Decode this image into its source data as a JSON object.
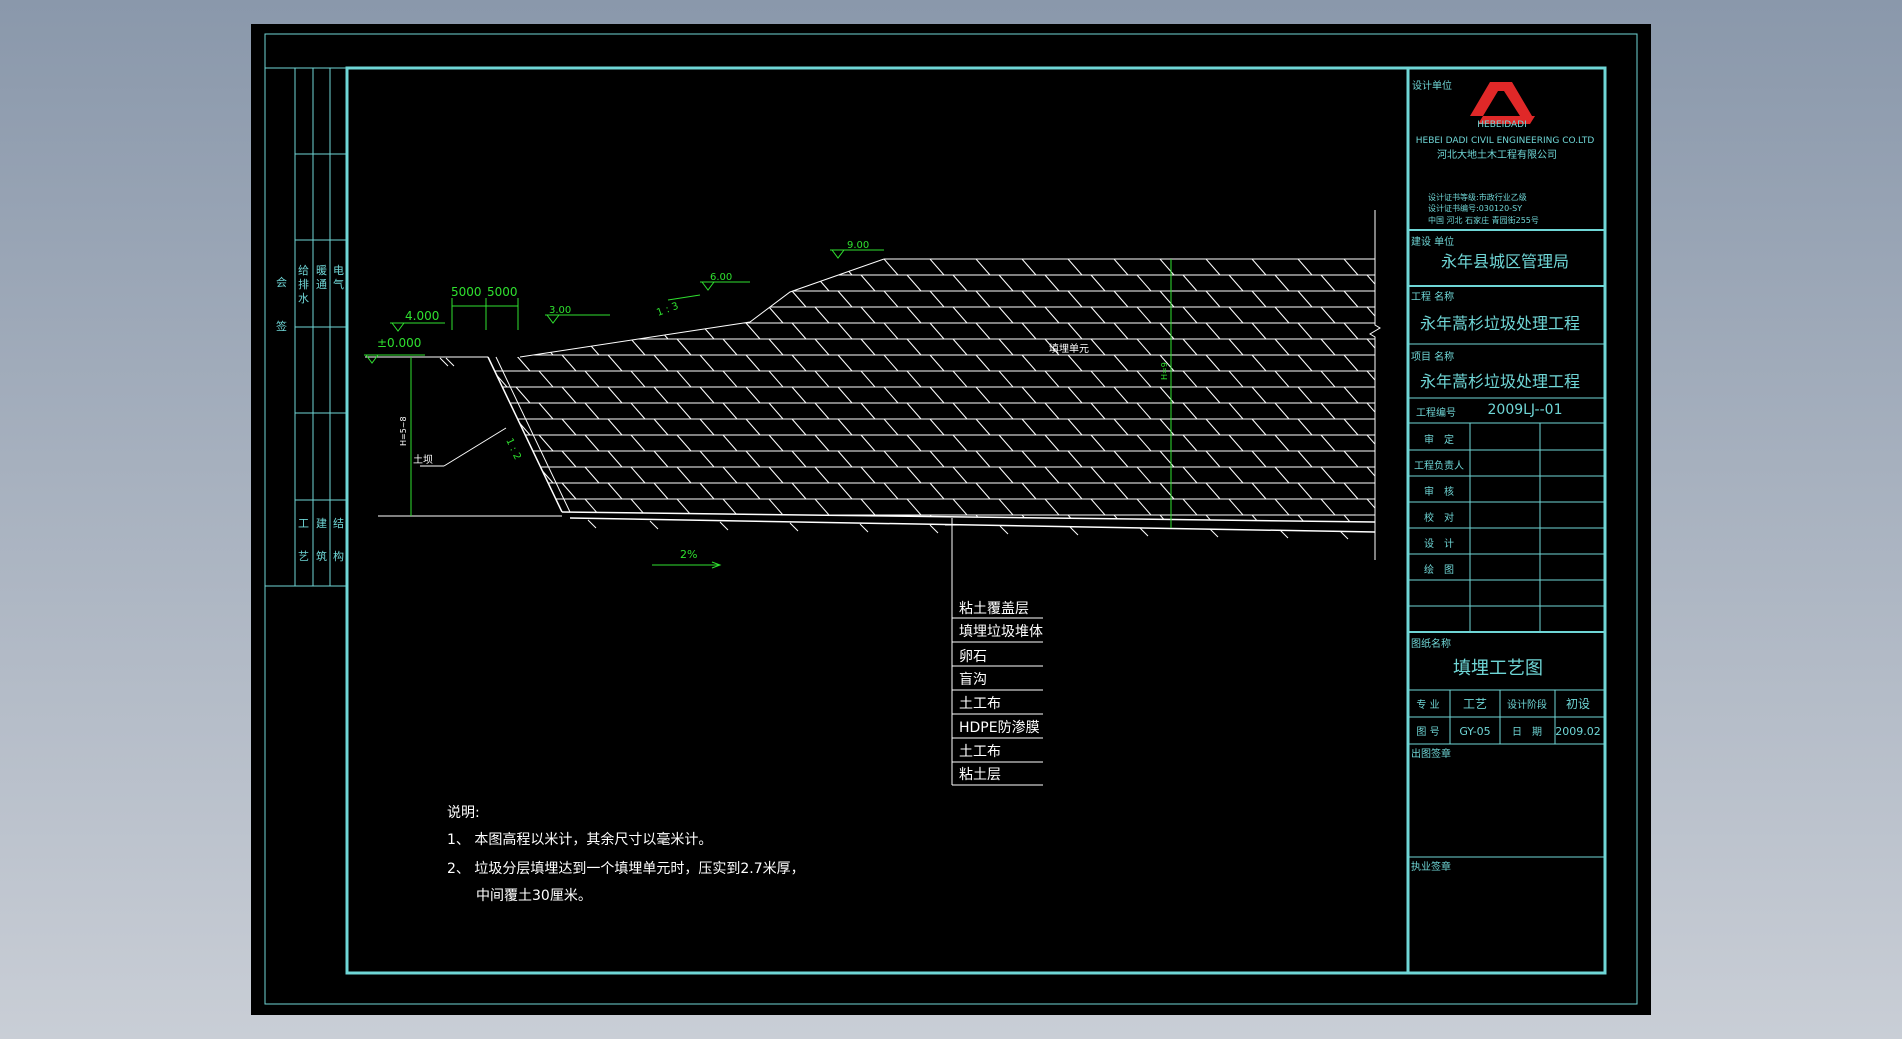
{
  "colors": {
    "background_top": "#8a98ab",
    "background_bottom": "#c9ced6",
    "sheet": "#000000",
    "frame": "#6fd6d6",
    "line": "#ffffff",
    "dimension": "#2fe02f",
    "brick": "#ffffff"
  },
  "title_block": {
    "design_unit_label": "设计单位",
    "logo_text": "HEBEIDADI",
    "company_en": "HEBEI DADI CIVIL ENGINEERING CO.LTD",
    "company_cn": "河北大地土木工程有限公司",
    "cert_grade": "设计证书等级:市政行业乙级",
    "cert_no": "设计证书编号:030120-SY",
    "address": "中国 河北 石家庄 青园街255号",
    "client_label": "建设 单位",
    "client": "永年县城区管理局",
    "project_label": "工程 名称",
    "project": "永年蒿杉垃圾处理工程",
    "item_label": "项目 名称",
    "item": "永年蒿杉垃圾处理工程",
    "project_no_label": "工程编号",
    "project_no": "2009LJ--01",
    "roles": [
      "审　定",
      "工程负责人",
      "审　核",
      "校　对",
      "设　计",
      "绘　图"
    ],
    "drawing_name_label": "图纸名称",
    "drawing_name": "填埋工艺图",
    "discipline_label": "专 业",
    "discipline": "工艺",
    "stage_label": "设计阶段",
    "stage": "初设",
    "drawing_no_label": "图 号",
    "drawing_no": "GY-05",
    "date_label": "日　期",
    "date": "2009.02",
    "issue_seal_label": "出图签章",
    "license_seal_label": "执业签章"
  },
  "left_strip": {
    "sign_col": [
      "会",
      "签"
    ],
    "disciplines_top": [
      [
        "给",
        "排",
        "水"
      ],
      [
        "暖",
        "通"
      ],
      [
        "电",
        "气"
      ]
    ],
    "disciplines_bottom": [
      [
        "工",
        "艺"
      ],
      [
        "建",
        "筑"
      ],
      [
        "结",
        "构"
      ]
    ]
  },
  "drawing": {
    "elevation_900": "9.00",
    "elevation_600": "6.00",
    "elevation_300": "3.00",
    "elevation_4000": "4.000",
    "elevation_0": "±0.000",
    "dim_5000_a": "5000",
    "dim_5000_b": "5000",
    "slope_1_3": "1 : 3",
    "slope_1_2": "1 : 2",
    "fill_unit": "填埋单元",
    "total_height": "H=9",
    "depth": "H=5~8",
    "soil_label": "土坝",
    "bottom_slope": "2%",
    "layers": [
      "粘土覆盖层",
      "填埋垃圾堆体",
      "卵石",
      "盲沟",
      "土工布",
      "HDPE防渗膜",
      "土工布",
      "粘土层"
    ]
  },
  "notes": {
    "title": "说明:",
    "line1": "1、 本图高程以米计，其余尺寸以毫米计。",
    "line2": "2、 垃圾分层填埋达到一个填埋单元时，压实到2.7米厚，",
    "line3": "中间覆土30厘米。"
  }
}
